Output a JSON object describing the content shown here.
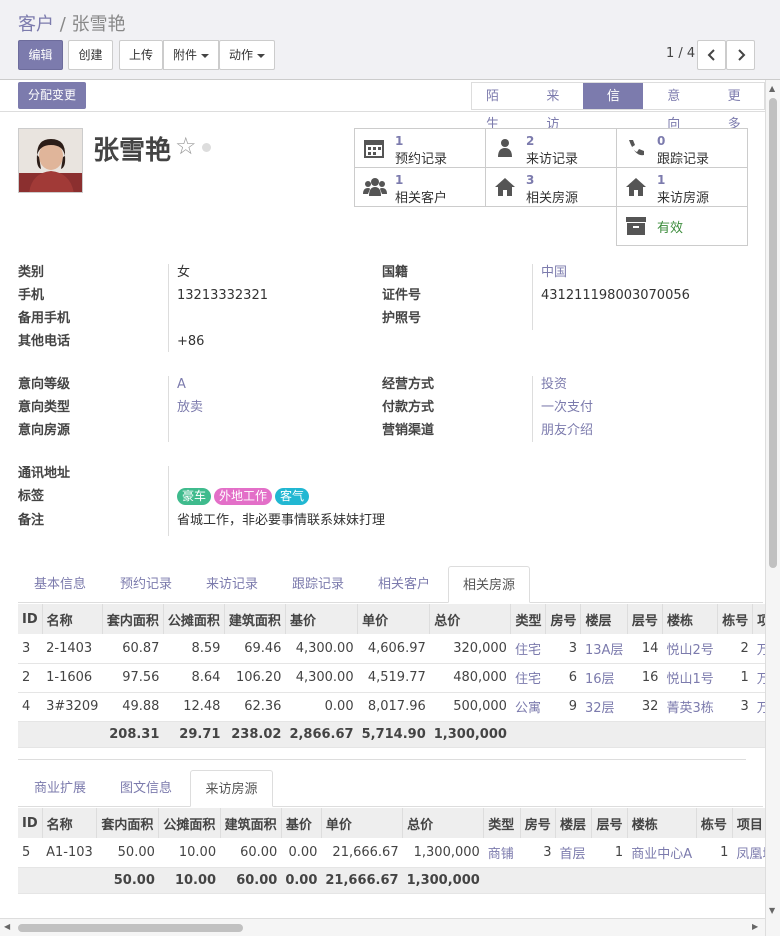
{
  "breadcrumb": {
    "parent": "客户",
    "sep": "/",
    "current": "张雪艳"
  },
  "toolbar": {
    "edit": "编辑",
    "create": "创建",
    "upload": "上传",
    "attachment": "附件",
    "action": "动作"
  },
  "pager": {
    "text": "1 / 4"
  },
  "assign_button": "分配变更",
  "stages": [
    {
      "label": "陌生",
      "active": false
    },
    {
      "label": "来访",
      "active": false
    },
    {
      "label": "信任",
      "active": true
    },
    {
      "label": "意向",
      "active": false
    },
    {
      "label": "更多",
      "active": false
    }
  ],
  "customer": {
    "name": "张雪艳"
  },
  "smart_buttons": [
    {
      "count": "1",
      "label": "预约记录",
      "icon": "calendar-icon"
    },
    {
      "count": "2",
      "label": "来访记录",
      "icon": "user-icon"
    },
    {
      "count": "0",
      "label": "跟踪记录",
      "icon": "phone-icon"
    },
    {
      "count": "1",
      "label": "相关客户",
      "icon": "users-icon"
    },
    {
      "count": "3",
      "label": "相关房源",
      "icon": "home-icon"
    },
    {
      "count": "1",
      "label": "来访房源",
      "icon": "home-icon"
    }
  ],
  "archive_button": {
    "label": "有效",
    "icon": "archive-icon"
  },
  "info_left": [
    {
      "label": "类别",
      "value": "女"
    },
    {
      "label": "手机",
      "value": "13213332321"
    },
    {
      "label": "备用手机",
      "value": ""
    },
    {
      "label": "其他电话",
      "value": "+86"
    }
  ],
  "info_right": [
    {
      "label": "国籍",
      "value": "中国"
    },
    {
      "label": "证件号",
      "value": "431211198003070056"
    },
    {
      "label": "护照号",
      "value": ""
    }
  ],
  "intent_left": [
    {
      "label": "意向等级",
      "value": "A"
    },
    {
      "label": "意向类型",
      "value": "放卖"
    },
    {
      "label": "意向房源",
      "value": ""
    }
  ],
  "intent_right": [
    {
      "label": "经营方式",
      "value": "投资"
    },
    {
      "label": "付款方式",
      "value": "一次支付"
    },
    {
      "label": "营销渠道",
      "value": "朋友介绍"
    }
  ],
  "address": {
    "label": "通讯地址",
    "value": ""
  },
  "tags": {
    "label": "标签",
    "items": [
      {
        "text": "豪车",
        "color": "#3fbb8d"
      },
      {
        "text": "外地工作",
        "color": "#e36fc8"
      },
      {
        "text": "客气",
        "color": "#21b7d2"
      }
    ]
  },
  "remark": {
    "label": "备注",
    "value": "省城工作，非必要事情联系妹妹打理"
  },
  "tabs1": [
    {
      "label": "基本信息",
      "active": false
    },
    {
      "label": "预约记录",
      "active": false
    },
    {
      "label": "来访记录",
      "active": false
    },
    {
      "label": "跟踪记录",
      "active": false
    },
    {
      "label": "相关客户",
      "active": false
    },
    {
      "label": "相关房源",
      "active": true
    }
  ],
  "table1": {
    "headers": [
      "ID",
      "名称",
      "套内面积",
      "公摊面积",
      "建筑面积",
      "基价",
      "单价",
      "总价",
      "类型",
      "房号",
      "楼层",
      "层号",
      "楼栋",
      "栋号",
      "项目"
    ],
    "rows": [
      [
        "3",
        "2-1403",
        "60.87",
        "8.59",
        "69.46",
        "4,300.00",
        "4,606.97",
        "320,000",
        "住宅",
        "3",
        "13A层",
        "14",
        "悦山2号",
        "2",
        "万科城"
      ],
      [
        "2",
        "1-1606",
        "97.56",
        "8.64",
        "106.20",
        "4,300.00",
        "4,519.77",
        "480,000",
        "住宅",
        "6",
        "16层",
        "16",
        "悦山1号",
        "1",
        "万科城"
      ],
      [
        "4",
        "3#3209",
        "49.88",
        "12.48",
        "62.36",
        "0.00",
        "8,017.96",
        "500,000",
        "公寓",
        "9",
        "32层",
        "32",
        "菁英3栋",
        "3",
        "万达城"
      ]
    ],
    "totals": [
      "",
      "",
      "208.31",
      "29.71",
      "238.02",
      "2,866.67",
      "5,714.90",
      "1,300,000",
      "",
      "",
      "",
      "",
      "",
      "",
      ""
    ]
  },
  "tabs2": [
    {
      "label": "商业扩展",
      "active": false
    },
    {
      "label": "图文信息",
      "active": false
    },
    {
      "label": "来访房源",
      "active": true
    }
  ],
  "table2": {
    "headers": [
      "ID",
      "名称",
      "套内面积",
      "公摊面积",
      "建筑面积",
      "基价",
      "单价",
      "总价",
      "类型",
      "房号",
      "楼层",
      "层号",
      "楼栋",
      "栋号",
      "项目"
    ],
    "rows": [
      [
        "5",
        "A1-103",
        "50.00",
        "10.00",
        "60.00",
        "0.00",
        "21,666.67",
        "1,300,000",
        "商铺",
        "3",
        "首层",
        "1",
        "商业中心A",
        "1",
        "凤凰城"
      ]
    ],
    "totals": [
      "",
      "",
      "50.00",
      "10.00",
      "60.00",
      "0.00",
      "21,666.67",
      "1,300,000",
      "",
      "",
      "",
      "",
      "",
      "",
      ""
    ]
  },
  "colors": {
    "primary": "#7c7bad",
    "link": "#7c7bad"
  }
}
